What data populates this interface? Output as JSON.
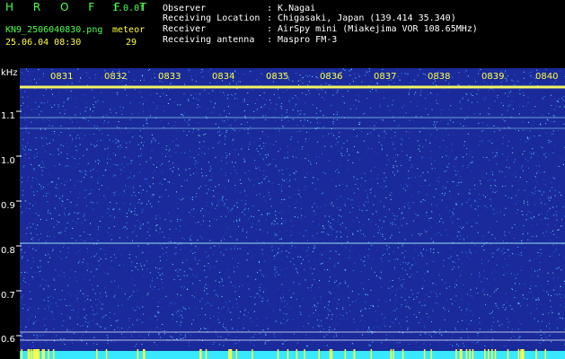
{
  "header": {
    "app_title": "H R O F F T",
    "version": "1.0.0f",
    "filename": "KN9_2506040830.png",
    "meteor_label": "meteor",
    "timestamp": "25.06.04 08:30",
    "meteor_count": "29",
    "observer_label": "Observer",
    "observer_value": ": K.Nagai",
    "location_label": "Receiving Location",
    "location_value": ": Chigasaki, Japan (139.414 35.340)",
    "receiver_label": "Receiver",
    "receiver_value": ": AirSpy mini (Miakejima VOR 108.65MHz)",
    "antenna_label": "Receiving antenna",
    "antenna_value": ": Maspro FM-3"
  },
  "axis": {
    "y_unit": "kHz",
    "y_ticks": [
      "1.1",
      "1.0",
      "0.9",
      "0.8",
      "0.7",
      "0.6"
    ],
    "time_ticks": [
      "0831",
      "0832",
      "0833",
      "0834",
      "0835",
      "0836",
      "0837",
      "0838",
      "0839",
      "0840"
    ]
  },
  "colors": {
    "background": "#1a2a9a",
    "noise": "#3aa0ff",
    "carrier": "#ffff60",
    "time_label": "#ffff40",
    "header_green": "#4cff4c"
  }
}
